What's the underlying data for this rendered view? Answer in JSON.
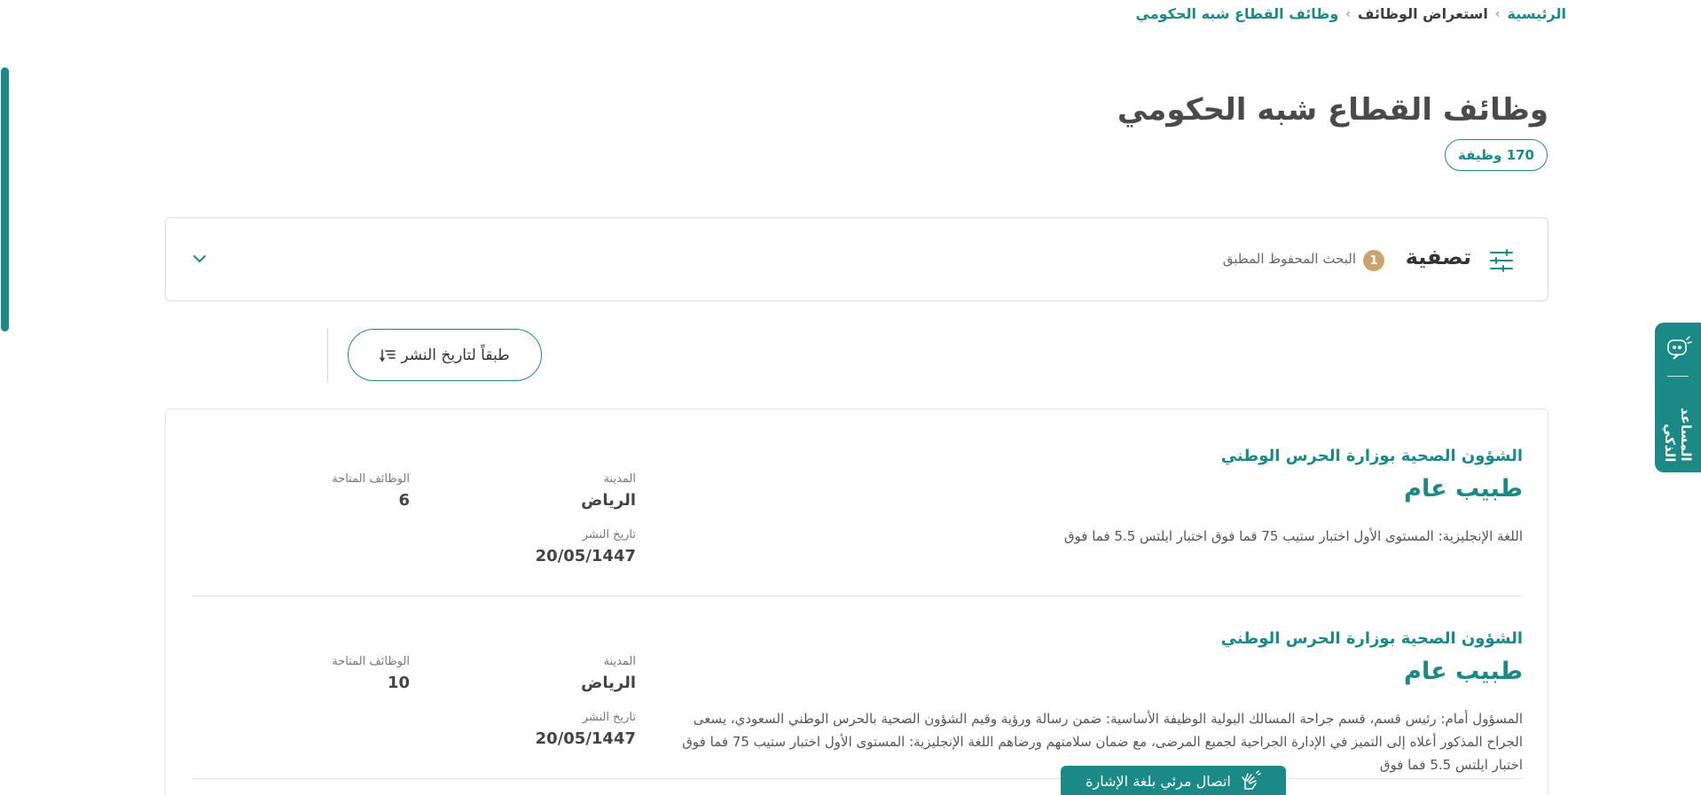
{
  "breadcrumb": {
    "home": "الرئيسية",
    "browse": "استعراض الوظائف",
    "current": "وظائف القطاع شبه الحكومي",
    "separator": "›"
  },
  "page": {
    "title": "وظائف القطاع شبه الحكومي",
    "count": "170 وظيفة"
  },
  "filter": {
    "title": "تصفية",
    "saved_count": "1",
    "saved_label": "البحث المحفوظ المطبق"
  },
  "sort": {
    "label": "طبقاً لتاريخ النشر"
  },
  "jobs": [
    {
      "org": "الشؤون الصحية بوزارة الحرس الوطني",
      "title": "طبيب عام",
      "desc": "اللغة الإنجليزية: المستوى الأول اختبار ستيب 75 فما فوق اختبار ايلتس 5.5 فما فوق",
      "city_label": "المدينة",
      "city": "الرياض",
      "date_label": "تاريخ النشر",
      "date": "20/05/1447",
      "vacancies_label": "الوظائف المتاحة",
      "vacancies": "6"
    },
    {
      "org": "الشؤون الصحية بوزارة الحرس الوطني",
      "title": "طبيب عام",
      "desc": "المسؤول أمام: رئيس قسم، قسم جراحة المسالك البولية الوظيفة الأساسية: ضمن رسالة ورؤية وقيم الشؤون الصحية بالحرس الوطني السعودي، يسعى الجراح المذكور أعلاه إلى التميز في الإدارة الجراحية لجميع المرضى، مع ضمان سلامتهم ورضاهم اللغة الإنجليزية: المستوى الأول اختبار ستيب 75 فما فوق اختبار ايلتس 5.5 فما فوق",
      "city_label": "المدينة",
      "city": "الرياض",
      "date_label": "تاريخ النشر",
      "date": "20/05/1447",
      "vacancies_label": "الوظائف المتاحة",
      "vacancies": "10"
    }
  ],
  "assistant": {
    "label": "المساعد الذكي"
  },
  "sign_language": {
    "label": "اتصال مرئي بلغة الإشارة"
  },
  "colors": {
    "accent": "#1b8a86",
    "badge_gold": "#c9a56d"
  }
}
